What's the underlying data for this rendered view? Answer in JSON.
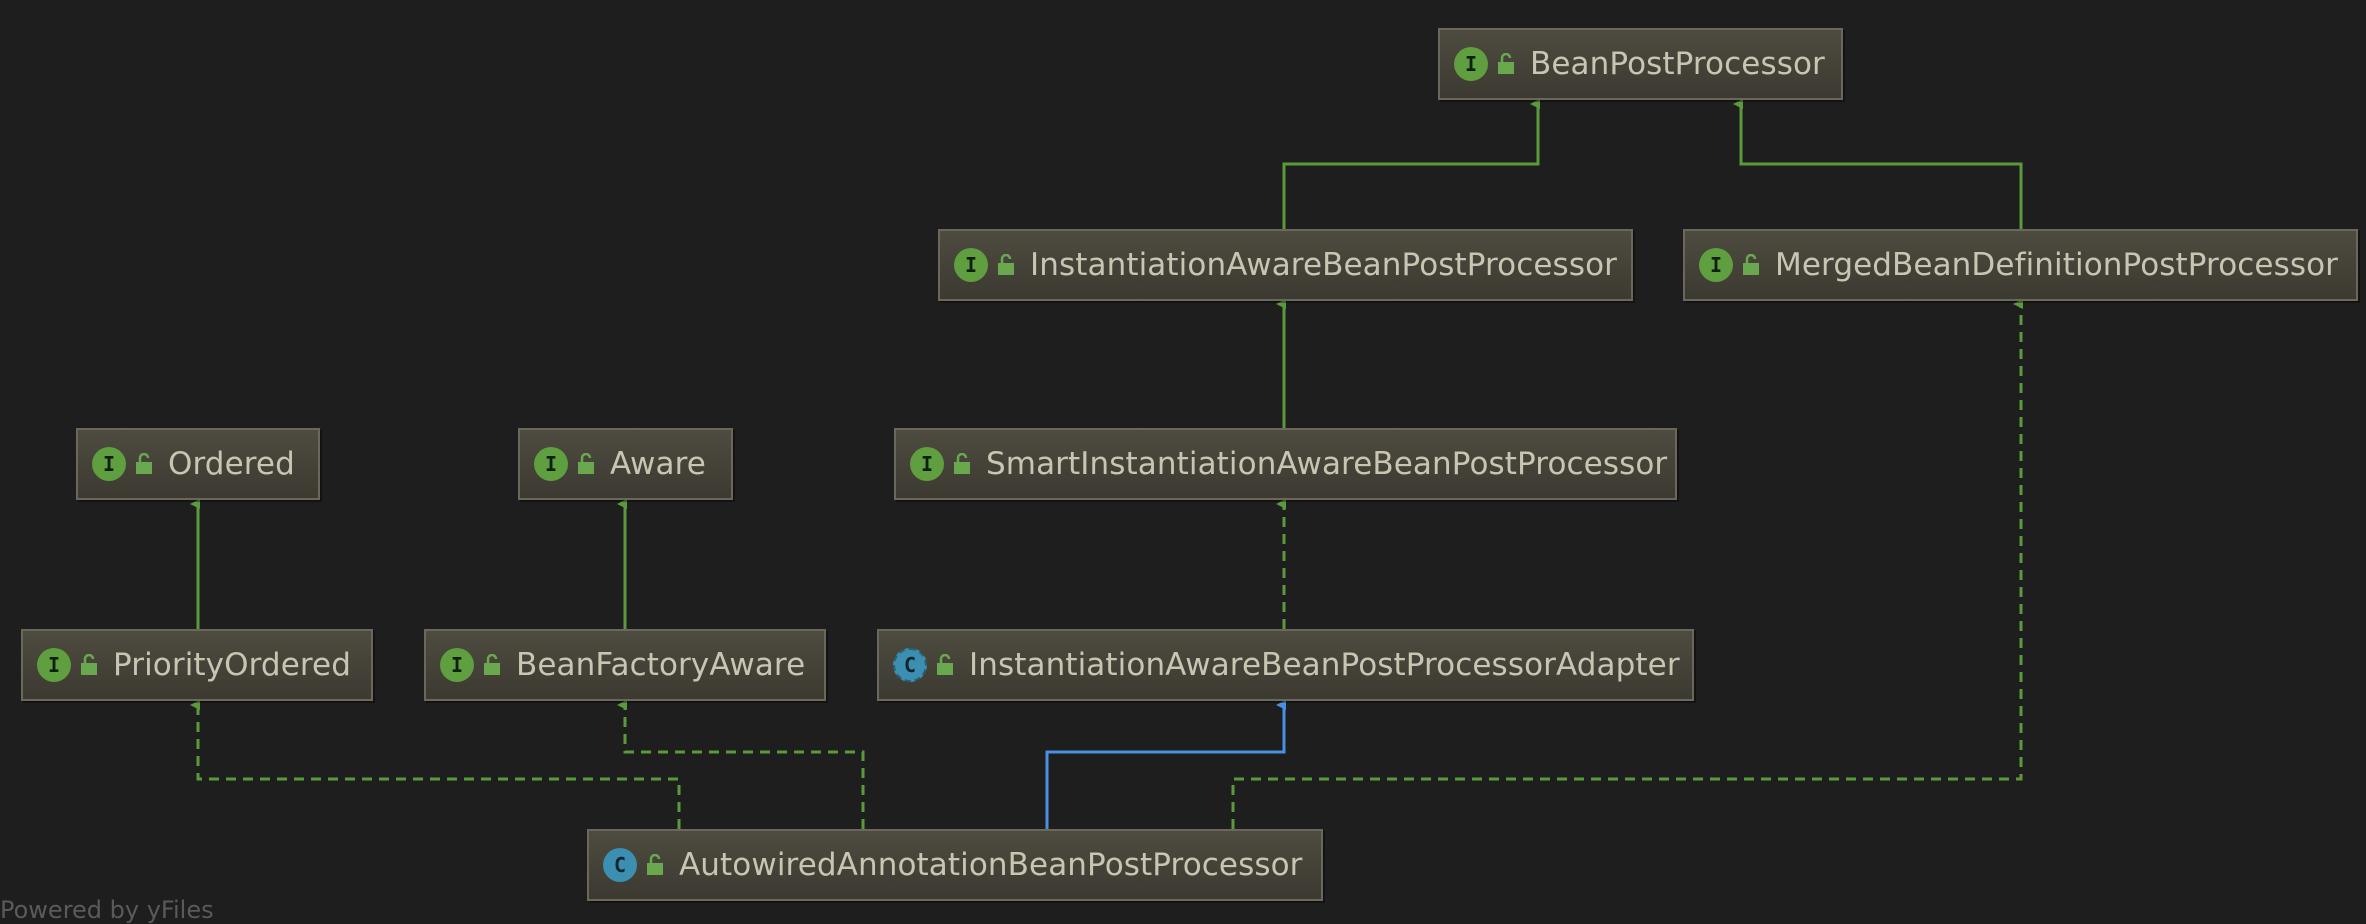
{
  "diagram": {
    "footer": "Powered by yFiles",
    "nodes": [
      {
        "id": "bpp",
        "name": "BeanPostProcessor",
        "kind": "interface",
        "badge": "I"
      },
      {
        "id": "iabpp",
        "name": "InstantiationAwareBeanPostProcessor",
        "kind": "interface",
        "badge": "I"
      },
      {
        "id": "mbdpp",
        "name": "MergedBeanDefinitionPostProcessor",
        "kind": "interface",
        "badge": "I"
      },
      {
        "id": "ordered",
        "name": "Ordered",
        "kind": "interface",
        "badge": "I"
      },
      {
        "id": "aware",
        "name": "Aware",
        "kind": "interface",
        "badge": "I"
      },
      {
        "id": "siabpp",
        "name": "SmartInstantiationAwareBeanPostProcessor",
        "kind": "interface",
        "badge": "I"
      },
      {
        "id": "priorityordered",
        "name": "PriorityOrdered",
        "kind": "interface",
        "badge": "I"
      },
      {
        "id": "bfaware",
        "name": "BeanFactoryAware",
        "kind": "interface",
        "badge": "I"
      },
      {
        "id": "iabppadapter",
        "name": "InstantiationAwareBeanPostProcessorAdapter",
        "kind": "abstract-class",
        "badge": "C"
      },
      {
        "id": "aabpp",
        "name": "AutowiredAnnotationBeanPostProcessor",
        "kind": "class",
        "badge": "C"
      }
    ],
    "edges": [
      {
        "from": "iabpp",
        "to": "bpp",
        "relation": "extends"
      },
      {
        "from": "mbdpp",
        "to": "bpp",
        "relation": "extends"
      },
      {
        "from": "siabpp",
        "to": "iabpp",
        "relation": "extends"
      },
      {
        "from": "iabppadapter",
        "to": "siabpp",
        "relation": "implements"
      },
      {
        "from": "priorityordered",
        "to": "ordered",
        "relation": "extends"
      },
      {
        "from": "bfaware",
        "to": "aware",
        "relation": "extends"
      },
      {
        "from": "aabpp",
        "to": "priorityordered",
        "relation": "implements"
      },
      {
        "from": "aabpp",
        "to": "bfaware",
        "relation": "implements"
      },
      {
        "from": "aabpp",
        "to": "iabppadapter",
        "relation": "extends-class"
      },
      {
        "from": "aabpp",
        "to": "mbdpp",
        "relation": "implements"
      }
    ],
    "colors": {
      "background": "#1e1e1e",
      "interface_edge": "#5a9a3c",
      "class_edge": "#4a90e2",
      "node_text": "#c9c5b2"
    }
  }
}
